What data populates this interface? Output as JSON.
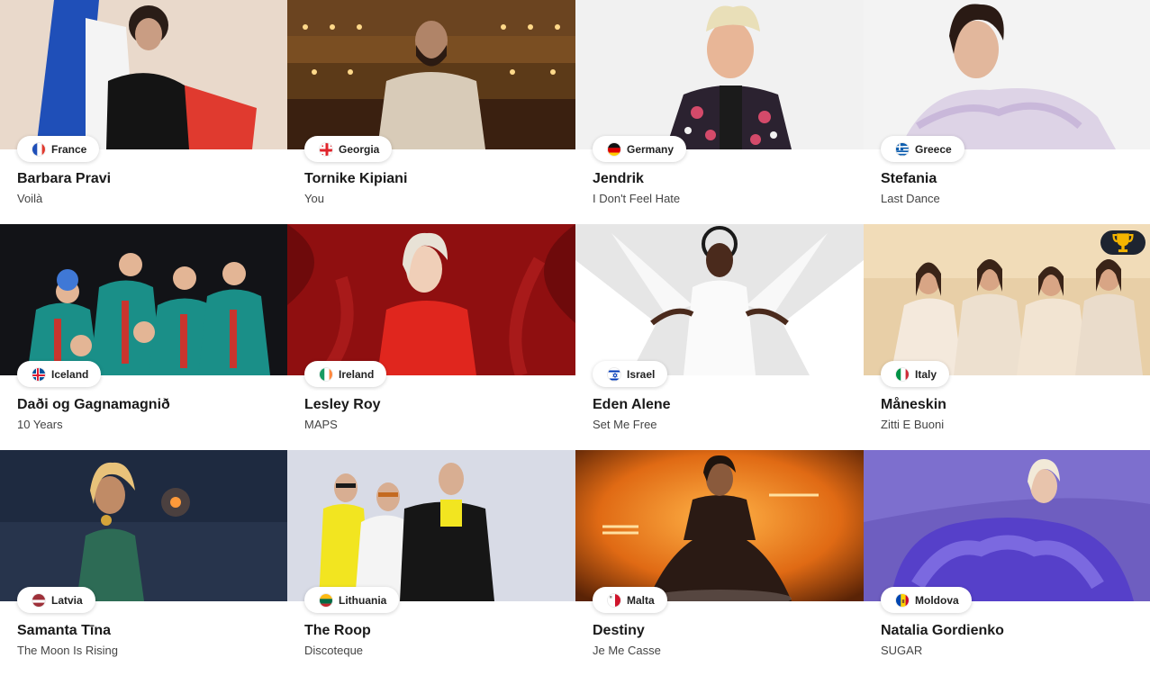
{
  "entries": [
    {
      "country": "France",
      "artist": "Barbara Pravi",
      "song": "Voilà",
      "flag": "france"
    },
    {
      "country": "Georgia",
      "artist": "Tornike Kipiani",
      "song": "You",
      "flag": "georgia"
    },
    {
      "country": "Germany",
      "artist": "Jendrik",
      "song": "I Don't Feel Hate",
      "flag": "germany"
    },
    {
      "country": "Greece",
      "artist": "Stefania",
      "song": "Last Dance",
      "flag": "greece"
    },
    {
      "country": "Iceland",
      "artist": "Daði og Gagnamagnið",
      "song": "10 Years",
      "flag": "iceland"
    },
    {
      "country": "Ireland",
      "artist": "Lesley Roy",
      "song": "MAPS",
      "flag": "ireland"
    },
    {
      "country": "Israel",
      "artist": "Eden Alene",
      "song": "Set Me Free",
      "flag": "israel"
    },
    {
      "country": "Italy",
      "artist": "Måneskin",
      "song": "Zitti E Buoni",
      "flag": "italy",
      "winner": true
    },
    {
      "country": "Latvia",
      "artist": "Samanta Tīna",
      "song": "The Moon Is Rising",
      "flag": "latvia"
    },
    {
      "country": "Lithuania",
      "artist": "The Roop",
      "song": "Discoteque",
      "flag": "lithuania"
    },
    {
      "country": "Malta",
      "artist": "Destiny",
      "song": "Je Me Casse",
      "flag": "malta"
    },
    {
      "country": "Moldova",
      "artist": "Natalia Gordienko",
      "song": "SUGAR",
      "flag": "moldova"
    }
  ],
  "icons": {
    "winner": "trophy-icon"
  }
}
